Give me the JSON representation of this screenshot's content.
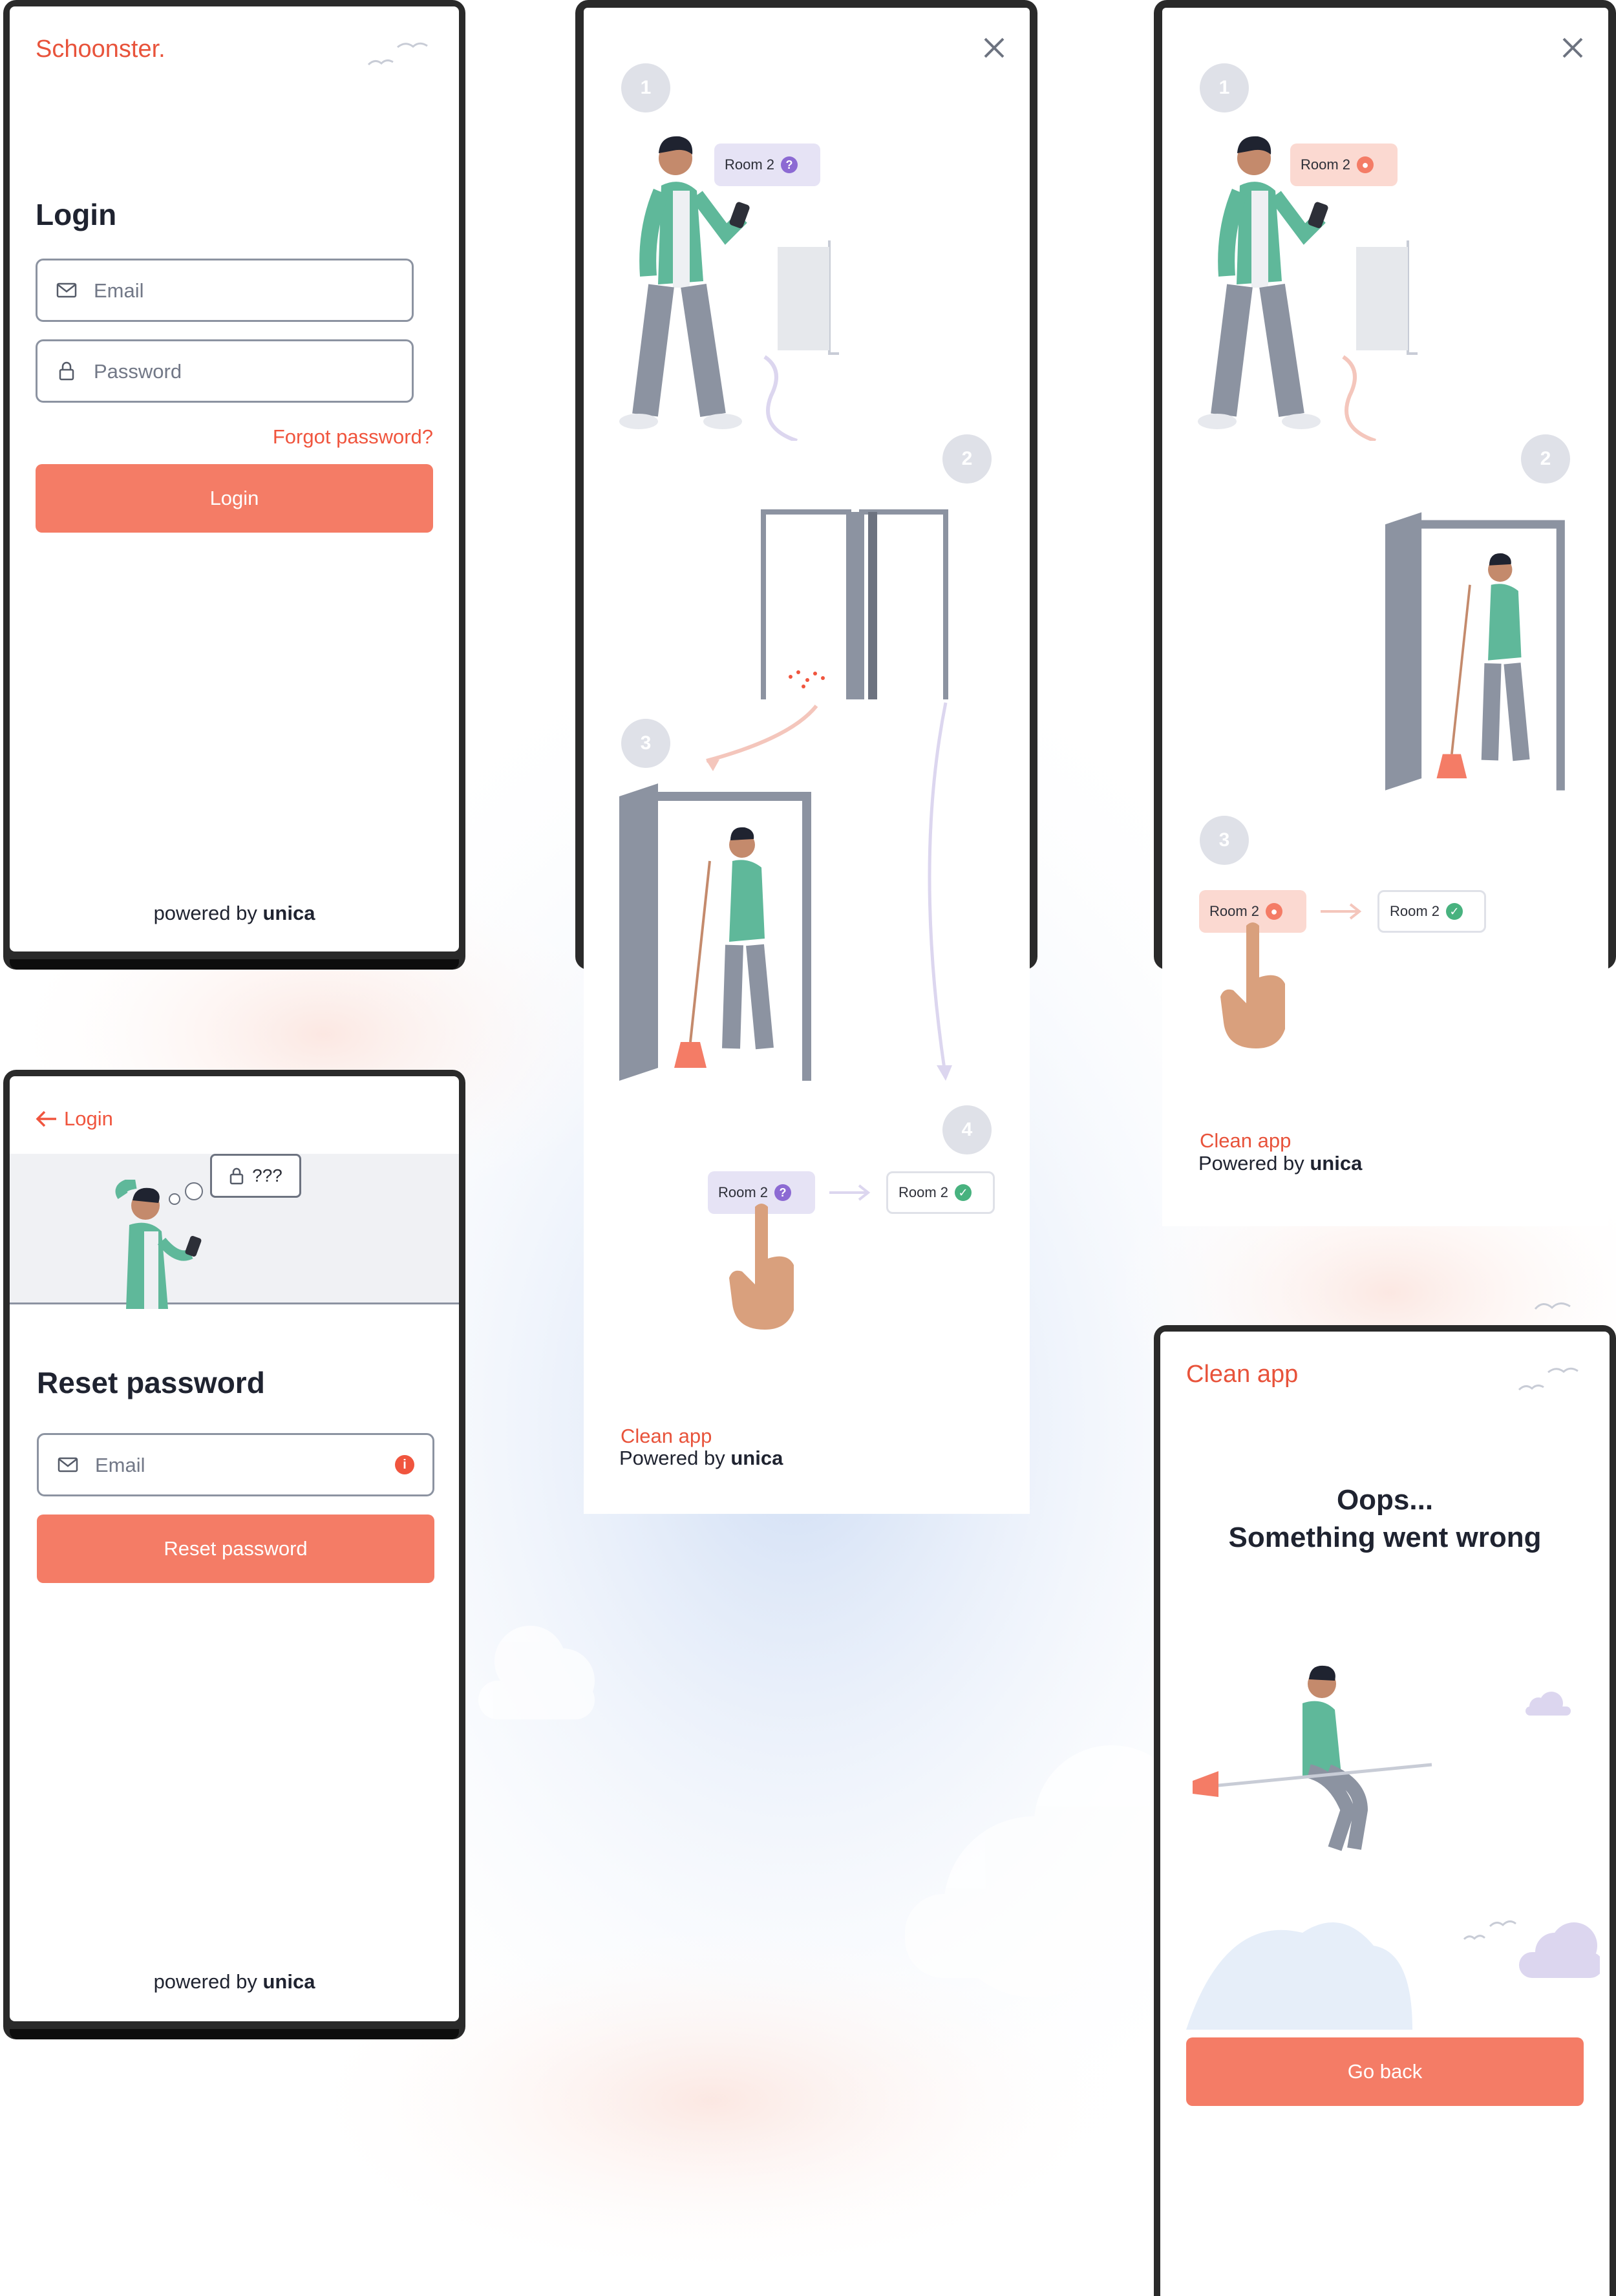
{
  "colors": {
    "accent": "#f47c66",
    "brand": "#e8533b",
    "teal": "#5fb89a",
    "dark": "#1f2330",
    "grey": "#8c93a1",
    "purple": "#8c6ad3",
    "green": "#48b27f"
  },
  "login": {
    "brand": "Schoonster.",
    "title": "Login",
    "email_placeholder": "Email",
    "password_placeholder": "Password",
    "forgot": "Forgot password?",
    "button": "Login",
    "powered_prefix": "powered by",
    "powered_brand": "unica",
    "email_icon": "mail-icon",
    "password_icon": "lock-icon"
  },
  "flow1": {
    "steps": [
      "1",
      "2",
      "3",
      "4"
    ],
    "room_chip": "Room 2",
    "room_chip_done": "Room 2",
    "footer_app": "Clean app",
    "footer_prefix": "Powered by",
    "footer_brand": "unica"
  },
  "flow2": {
    "steps": [
      "1",
      "2",
      "3"
    ],
    "room_chip": "Room 2",
    "room_chip_done": "Room 2",
    "footer_app": "Clean app",
    "footer_prefix": "Powered by",
    "footer_brand": "unica"
  },
  "reset": {
    "back": "Login",
    "bubble": "???",
    "title": "Reset password",
    "email_placeholder": "Email",
    "button": "Reset password",
    "powered_prefix": "powered by",
    "powered_brand": "unica"
  },
  "error": {
    "brand": "Clean app",
    "title_line1": "Oops...",
    "title_line2": "Something went wrong",
    "button": "Go back"
  }
}
